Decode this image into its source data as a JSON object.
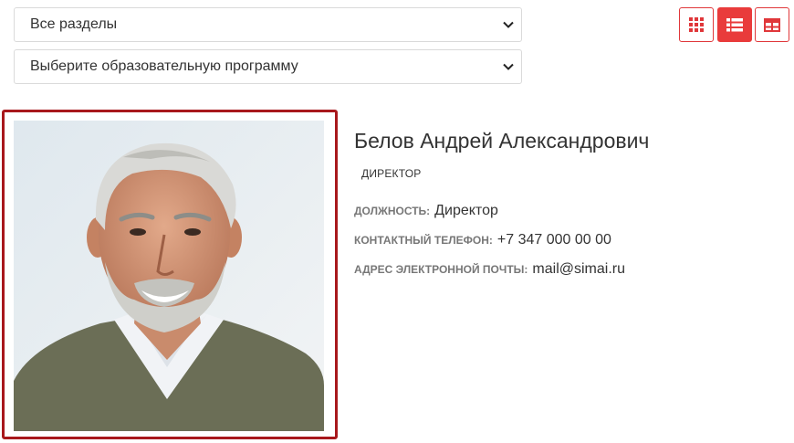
{
  "filters": {
    "section_select": "Все разделы",
    "program_select": "Выберите образовательную программу"
  },
  "view_toggle": {
    "grid_icon": "grid-icon",
    "list_icon": "list-icon",
    "table_icon": "table-icon",
    "active": "list",
    "accent_color": "#e93b3b"
  },
  "person": {
    "name": "Белов Андрей Александрович",
    "role_tag": "директор",
    "fields": [
      {
        "label": "Должность:",
        "value": "Директор"
      },
      {
        "label": "Контактный телефон:",
        "value": "+7 347 000 00 00"
      },
      {
        "label": "Адрес электронной почты:",
        "value": "mail@simai.ru"
      }
    ],
    "frame_color": "#a8181c"
  }
}
